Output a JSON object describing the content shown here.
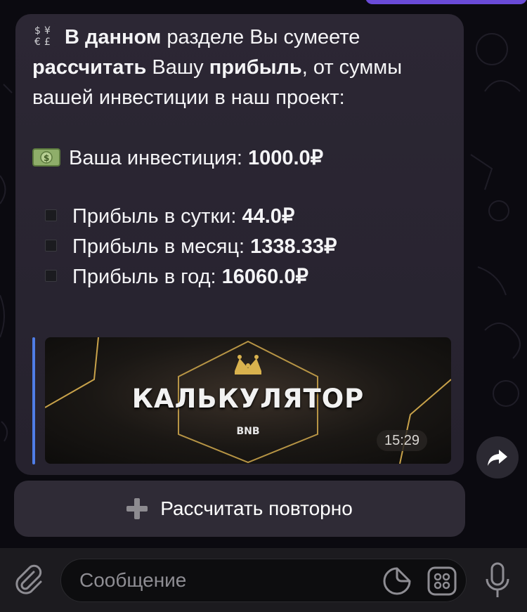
{
  "message": {
    "intro_bold_1": "В данном",
    "intro_text_1": " разделе Вы сумеете",
    "intro_bold_2": "рассчитать",
    "intro_text_2": " Вашу ",
    "intro_bold_3": "прибыль",
    "intro_text_3": ", от суммы вашей инвестиции в наш проект:",
    "investment_label": "Ваша инвестиция: ",
    "investment_value": "1000.0₽",
    "profits": [
      {
        "label": "Прибыль в сутки: ",
        "value": "44.0₽"
      },
      {
        "label": "Прибыль в месяц: ",
        "value": "1338.33₽"
      },
      {
        "label": "Прибыль в год: ",
        "value": "16060.0₽"
      }
    ],
    "time": "15:29"
  },
  "preview": {
    "title": "КАЛЬКУЛЯТОР",
    "subtitle": "BNB"
  },
  "keyboard": {
    "recalculate_label": "Рассчитать повторно"
  },
  "composer": {
    "placeholder": "Сообщение"
  },
  "icons": {
    "exchange": "currency-exchange-icon",
    "money": "money-bill-icon",
    "bullet": "black-square-icon",
    "share": "share-arrow-icon",
    "plus": "plus-icon",
    "attach": "paperclip-icon",
    "sticker": "sticker-icon",
    "apps": "grid-icon",
    "mic": "microphone-icon"
  },
  "colors": {
    "accent_bar": "#4f7de6",
    "bubble": "#2c2734",
    "top_pill": "#6a4bd8",
    "gold": "#c8a24a"
  }
}
